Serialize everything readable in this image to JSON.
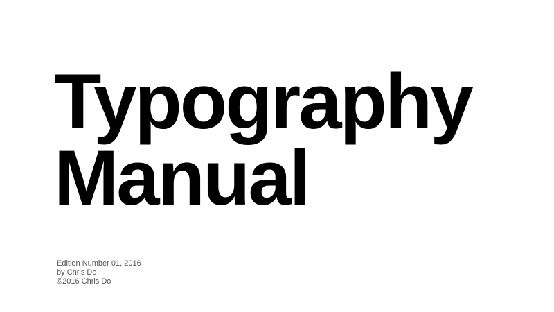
{
  "title": {
    "line1": "Typography",
    "line2": "Manual"
  },
  "credits": {
    "edition": "Edition Number 01, 2016",
    "author": "by Chris Do",
    "copyright": "©2016 Chris Do"
  }
}
